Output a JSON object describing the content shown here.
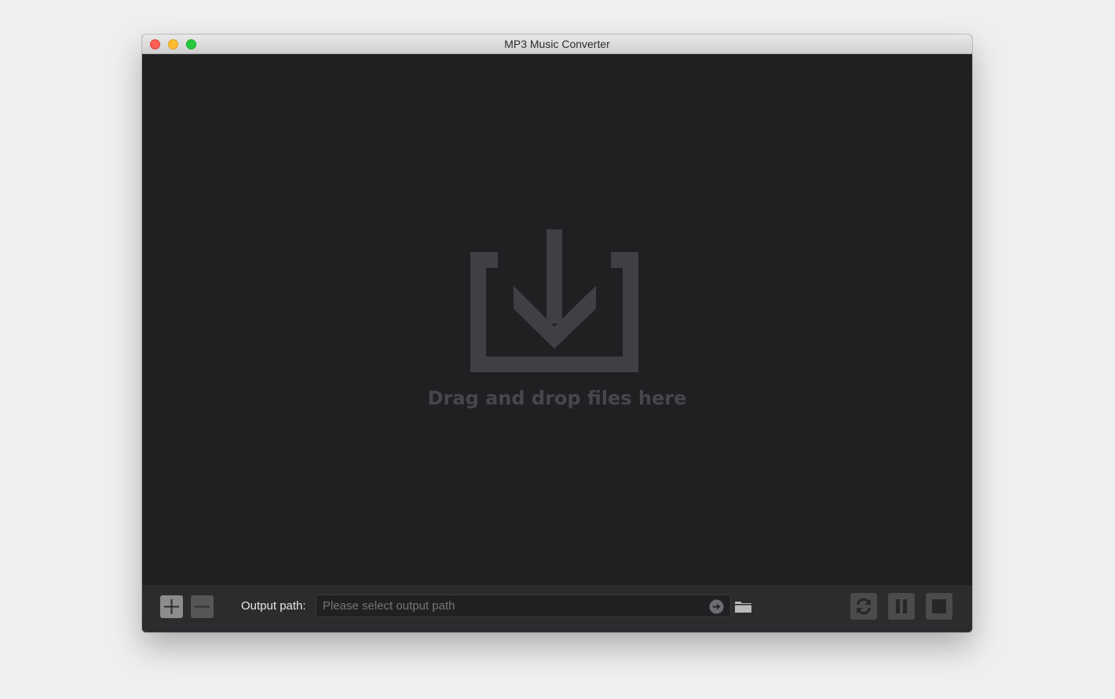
{
  "window": {
    "title": "MP3 Music Converter"
  },
  "dropzone": {
    "icon": "download-tray-icon",
    "message": "Drag and drop files here"
  },
  "toolbar": {
    "add_icon": "plus-icon",
    "remove_icon": "minus-icon",
    "output_label": "Output path:",
    "output_path_value": "",
    "output_path_placeholder": "Please select output path",
    "go_icon": "arrow-right-circle-icon",
    "browse_icon": "folder-icon",
    "convert_icon": "refresh-icon",
    "pause_icon": "pause-icon",
    "stop_icon": "stop-icon"
  },
  "colors": {
    "window_bg": "#1f2022",
    "toolbar_bg": "#2b2c2e",
    "dropzone_text": "#46474a",
    "close": "#fe5f57",
    "minimize": "#febc2e",
    "zoom": "#28c840"
  }
}
